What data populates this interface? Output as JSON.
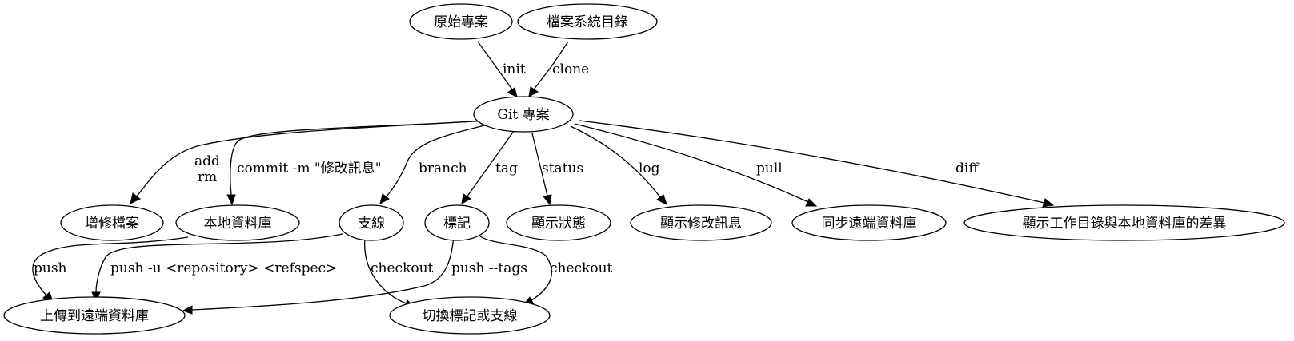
{
  "nodes": {
    "original_project": "原始專案",
    "filesystem_dir": "檔案系統目錄",
    "git_project": "Git 專案",
    "add_modify_files": "增修檔案",
    "local_repo": "本地資料庫",
    "branch": "支線",
    "tag": "標記",
    "show_status": "顯示狀態",
    "show_log": "顯示修改訊息",
    "sync_remote": "同步遠端資料庫",
    "show_diff": "顯示工作目錄與本地資料庫的差異",
    "upload_remote": "上傳到遠端資料庫",
    "switch_tag_branch": "切換標記或支線"
  },
  "edges": {
    "init": "init",
    "clone": "clone",
    "add_line1": "add",
    "add_line2": "rm",
    "commit": "commit -m \"修改訊息\"",
    "branch": "branch",
    "tag": "tag",
    "status": "status",
    "log": "log",
    "pull": "pull",
    "diff": "diff",
    "push": "push",
    "push_u": "push -u <repository> <refspec>",
    "checkout_branch": "checkout",
    "push_tags": "push --tags",
    "checkout_tag": "checkout"
  }
}
